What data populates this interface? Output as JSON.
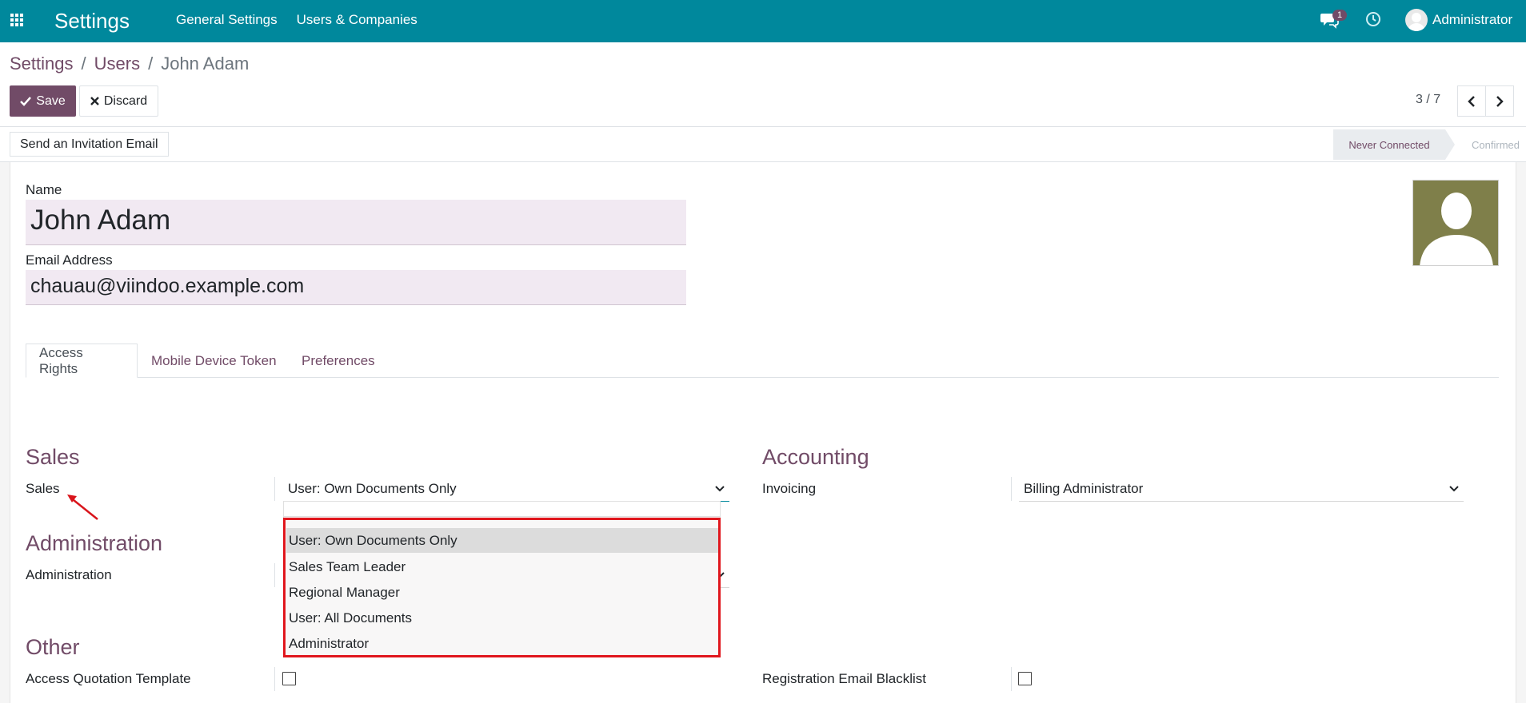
{
  "navbar": {
    "app_title": "Settings",
    "menu": [
      "General Settings",
      "Users & Companies"
    ],
    "chat_count": "1",
    "user_name": "Administrator"
  },
  "breadcrumb": {
    "items": [
      "Settings",
      "Users",
      "John Adam"
    ],
    "separator": "/"
  },
  "actions": {
    "save_label": "Save",
    "discard_label": "Discard"
  },
  "pager": {
    "value": "3 / 7"
  },
  "statusbar": {
    "invite_label": "Send an Invitation Email",
    "stages": [
      "Never Connected",
      "Confirmed"
    ]
  },
  "form": {
    "name_label": "Name",
    "name_value": "John Adam",
    "email_label": "Email Address",
    "email_value": "chauau@viindoo.example.com"
  },
  "tabs": [
    "Access Rights",
    "Mobile Device Token",
    "Preferences"
  ],
  "sections": {
    "sales": {
      "title": "Sales",
      "field_label": "Sales",
      "value": "User: Own Documents Only"
    },
    "accounting": {
      "title": "Accounting",
      "field_label": "Invoicing",
      "value": "Billing Administrator"
    },
    "administration": {
      "title": "Administration",
      "field_label": "Administration"
    },
    "other": {
      "title": "Other",
      "field_left": "Access Quotation Template",
      "field_right": "Registration Email Blacklist"
    }
  },
  "dropdown": {
    "options": [
      "User: Own Documents Only",
      "Sales Team Leader",
      "Regional Manager",
      "User: All Documents",
      "Administrator"
    ],
    "selected": "User: Own Documents Only"
  },
  "colors": {
    "navbar": "#00889c",
    "primary": "#714b67",
    "highlight": "#e0161d"
  }
}
